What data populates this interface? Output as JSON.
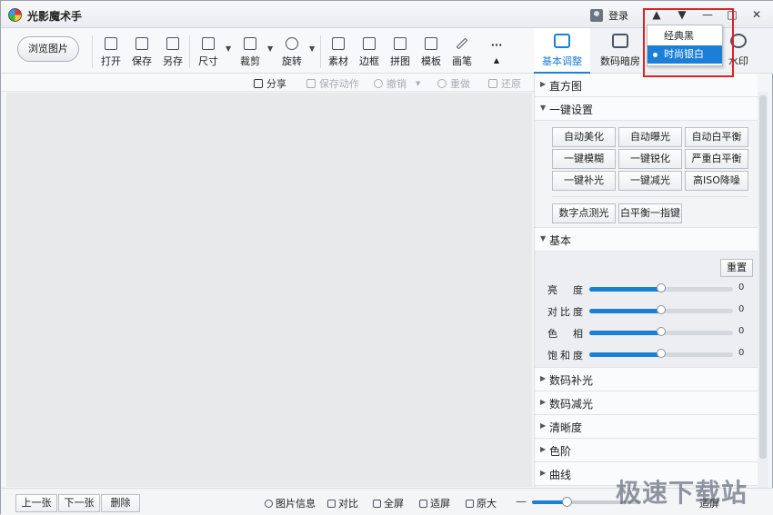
{
  "app": {
    "title": "光影魔术手",
    "login_label": "登录"
  },
  "window_controls": {
    "skin_icon": "▲",
    "menu_icon": "▼",
    "minimize": "—",
    "maximize": "□",
    "close": "✕"
  },
  "skin_menu": {
    "items": [
      {
        "label": "经典黑"
      },
      {
        "label": "时尚银白"
      }
    ],
    "selected_index": 1
  },
  "toolbar": {
    "browse_label": "浏览图片",
    "tools": [
      {
        "label": "打开",
        "icon": "open-icon"
      },
      {
        "label": "保存",
        "icon": "save-icon"
      },
      {
        "label": "另存",
        "icon": "save-as-icon"
      },
      {
        "label": "尺寸",
        "icon": "resize-icon"
      },
      {
        "label": "裁剪",
        "icon": "crop-icon"
      },
      {
        "label": "旋转",
        "icon": "rotate-icon"
      },
      {
        "label": "素材",
        "icon": "material-icon"
      },
      {
        "label": "边框",
        "icon": "border-icon"
      },
      {
        "label": "拼图",
        "icon": "collage-icon"
      },
      {
        "label": "模板",
        "icon": "template-icon"
      },
      {
        "label": "画笔",
        "icon": "brush-icon"
      }
    ],
    "more_label": "···"
  },
  "tabs": [
    {
      "label": "基本调整",
      "icon": "adjust-icon",
      "active": true
    },
    {
      "label": "数码暗房",
      "icon": "darkroom-icon",
      "active": false
    },
    {
      "label": "水印",
      "icon": "watermark-icon",
      "active": false
    }
  ],
  "actions": {
    "share": "分享",
    "save_action": "保存动作",
    "undo": "撤销",
    "redo": "重做",
    "restore": "还原"
  },
  "panel": {
    "histogram_label": "直方图",
    "onekey_label": "一键设置",
    "onekey_buttons": [
      "自动美化",
      "自动曝光",
      "自动白平衡",
      "一键模糊",
      "一键锐化",
      "严重白平衡",
      "一键补光",
      "一键减光",
      "高ISO降噪"
    ],
    "extra_buttons": [
      "数字点测光",
      "白平衡一指键"
    ],
    "basic_label": "基本",
    "reset_label": "重置",
    "sliders": [
      {
        "label": "亮　度",
        "value": "0",
        "level": 0.5
      },
      {
        "label": "对比度",
        "value": "0",
        "level": 0.5
      },
      {
        "label": "色　相",
        "value": "0",
        "level": 0.5
      },
      {
        "label": "饱和度",
        "value": "0",
        "level": 0.5
      }
    ],
    "sections": [
      "数码补光",
      "数码减光",
      "清晰度",
      "色阶",
      "曲线"
    ]
  },
  "bottom": {
    "prev": "上一张",
    "next": "下一张",
    "delete": "删除",
    "info": "图片信息",
    "compare": "对比",
    "fullscreen": "全屏",
    "fit": "适屏",
    "original": "原大",
    "zoom_level": 0.32,
    "fit_screen_label": "适屏"
  },
  "watermark": "极速下载站"
}
